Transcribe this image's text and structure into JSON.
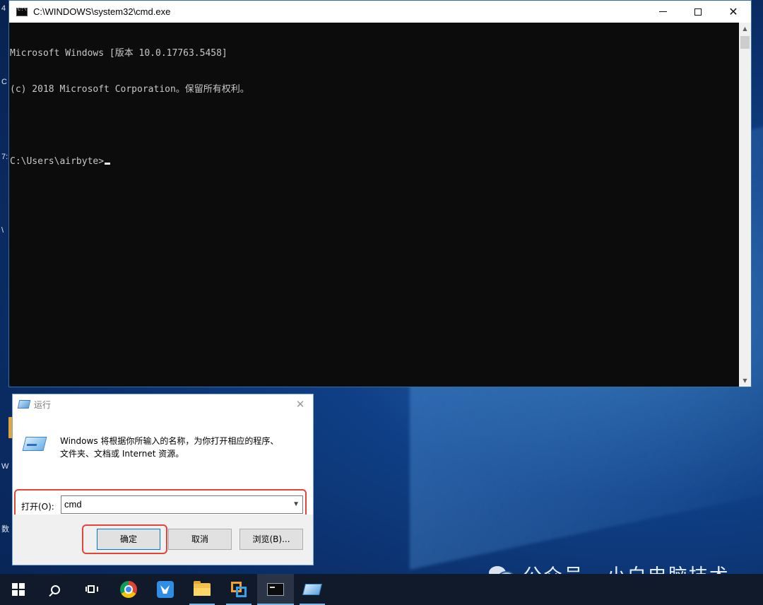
{
  "cmd_window": {
    "title": "C:\\WINDOWS\\system32\\cmd.exe",
    "lines": [
      "Microsoft Windows [版本 10.0.17763.5458]",
      "(c) 2018 Microsoft Corporation。保留所有权利。",
      "",
      "C:\\Users\\airbyte>"
    ],
    "controls": {
      "minimize": "",
      "maximize": "",
      "close": "✕"
    }
  },
  "run_dialog": {
    "title": "运行",
    "close_glyph": "✕",
    "description": "Windows 将根据你所输入的名称，为你打开相应的程序、\n文件夹、文档或 Internet 资源。",
    "open_label": "打开(O):",
    "open_value": "cmd",
    "buttons": {
      "ok": "确定",
      "cancel": "取消",
      "browse": "浏览(B)..."
    }
  },
  "desktop": {
    "edge_fragments": [
      "4",
      "C",
      "7:",
      "\\",
      "W",
      "数"
    ]
  },
  "watermark": {
    "text": "公众号 · 小白电脑技术"
  },
  "taskbar": {
    "items": [
      "start-icon",
      "search-icon",
      "task-view-icon",
      "chrome-icon",
      "bird-app-icon",
      "file-explorer-icon",
      "virtualbox-icon",
      "cmd-icon",
      "run-icon"
    ]
  },
  "colors": {
    "desktop_blue": "#0f3f86",
    "highlight_red": "#e4443a",
    "console_bg": "#0c0c0c",
    "taskbar_bg": "#101a2a",
    "accent": "#0078d7"
  }
}
